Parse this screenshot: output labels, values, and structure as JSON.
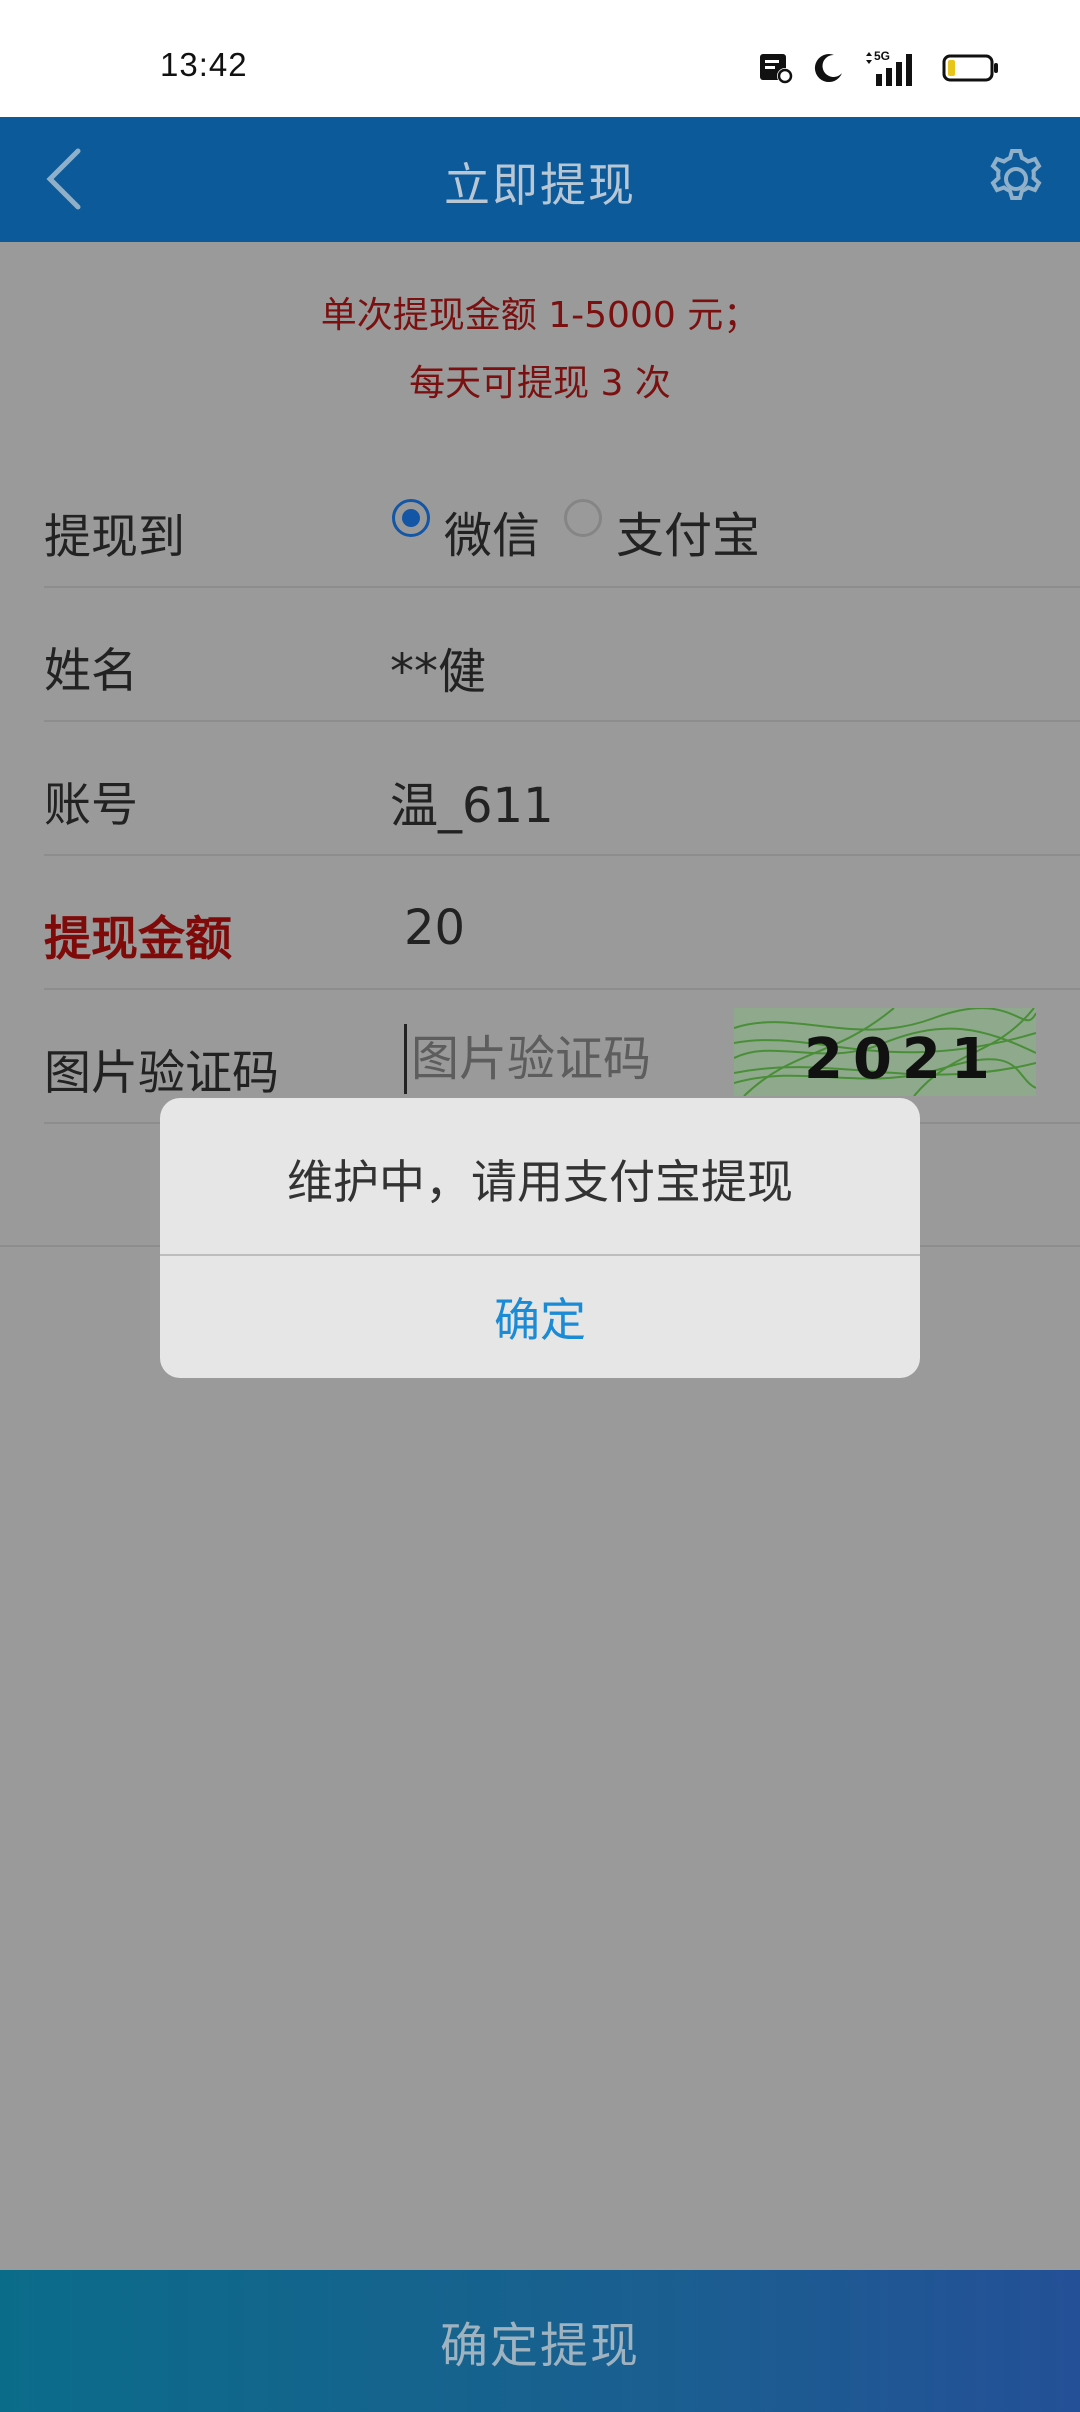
{
  "status_bar": {
    "time": "13:42",
    "icons": [
      "notification-icon",
      "moon-icon",
      "5g-signal-icon",
      "battery-icon"
    ],
    "network_label": "5G"
  },
  "nav": {
    "title": "立即提现",
    "back_icon": "chevron-left-icon",
    "settings_icon": "gear-icon"
  },
  "notice": {
    "line1": "单次提现金额 1-5000 元；",
    "line2": "每天可提现 3 次"
  },
  "form": {
    "withdraw_to_label": "提现到",
    "options": [
      "微信",
      "支付宝"
    ],
    "selected_option": "微信",
    "name_label": "姓名",
    "name_value": "**健",
    "account_label": "账号",
    "account_value": "温_611",
    "amount_label": "提现金额",
    "amount_value": "20",
    "captcha_label": "图片验证码",
    "captcha_placeholder": "图片验证码",
    "captcha_text": "2021"
  },
  "dialog": {
    "message": "维护中，请用支付宝提现",
    "ok_label": "确定"
  },
  "bottom": {
    "submit_label": "确定提现"
  },
  "colors": {
    "nav_bg": "#0c5a9a",
    "notice_red": "#7a1010",
    "dialog_ok_blue": "#1b8bd6",
    "overlay_gray": "#9a9a9a"
  }
}
